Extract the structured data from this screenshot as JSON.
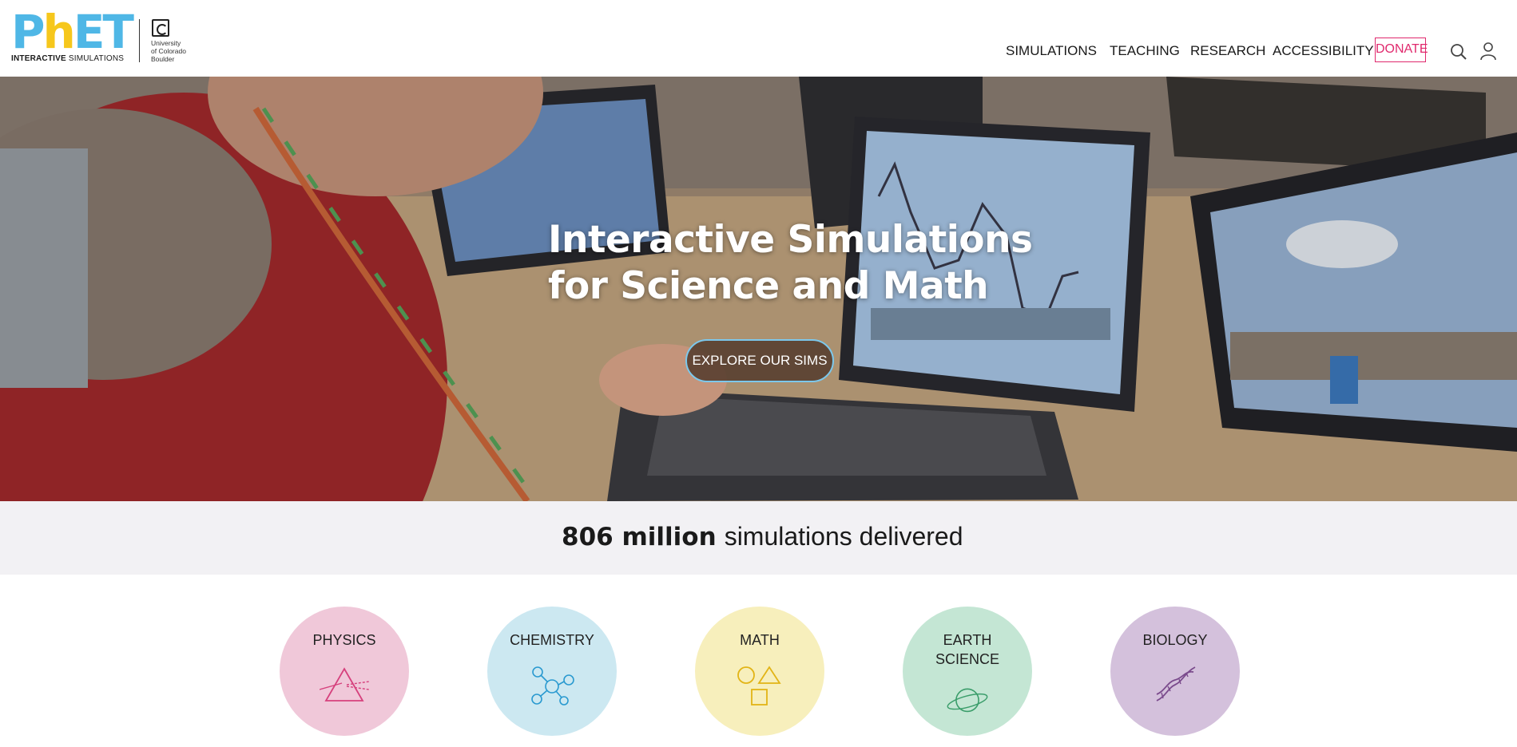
{
  "brand": {
    "logo_letters": [
      "Ph",
      "ET"
    ],
    "logo_p": "P",
    "logo_h": "h",
    "logo_et": "ET",
    "tagline_bold": "INTERACTIVE",
    "tagline_light": "SIMULATIONS",
    "university_line1": "University",
    "university_line2": "of Colorado",
    "university_line3": "Boulder"
  },
  "nav": {
    "items": [
      "SIMULATIONS",
      "TEACHING",
      "RESEARCH",
      "ACCESSIBILITY"
    ],
    "donate": "DONATE"
  },
  "hero": {
    "title_line1": "Interactive Simulations",
    "title_line2": "for Science and Math",
    "cta": "EXPLORE OUR SIMS"
  },
  "stats": {
    "number": "806 million",
    "label": "simulations delivered"
  },
  "categories": [
    {
      "label_line1": "PHYSICS",
      "label_line2": "",
      "color": "#f0c8d9",
      "icon": "prism-icon"
    },
    {
      "label_line1": "CHEMISTRY",
      "label_line2": "",
      "color": "#cce8f1",
      "icon": "molecule-icon"
    },
    {
      "label_line1": "MATH",
      "label_line2": "",
      "color": "#f7efbc",
      "icon": "shapes-icon"
    },
    {
      "label_line1": "EARTH",
      "label_line2": "SCIENCE",
      "color": "#c4e6d4",
      "icon": "planet-icon"
    },
    {
      "label_line1": "BIOLOGY",
      "label_line2": "",
      "color": "#d4c1dc",
      "icon": "dna-icon"
    }
  ],
  "colors": {
    "donate": "#e0296d",
    "cta_border": "#7cc8ec",
    "stats_bg": "#f2f1f4"
  }
}
